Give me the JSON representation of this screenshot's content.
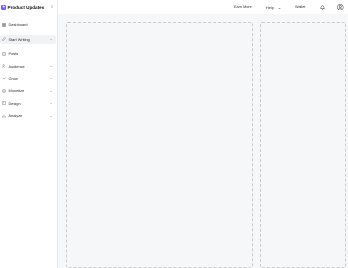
{
  "brand": {
    "name": "Product Updates",
    "logo_icon": "bolt-icon",
    "color": "#7c5cff"
  },
  "topbar": {
    "earn_more": "Earn More",
    "help": "Help",
    "wallet": "Wallet",
    "notifications_icon": "bell-icon",
    "avatar_icon": "user-avatar-icon"
  },
  "sidebar": {
    "items": [
      {
        "label": "Dashboard",
        "icon": "dashboard-icon",
        "has_chevron": false
      },
      {
        "label": "Start Writing",
        "icon": "pencil-icon",
        "has_chevron": true,
        "active": true
      },
      {
        "label": "Posts",
        "icon": "document-icon",
        "has_chevron": false
      },
      {
        "label": "Audience",
        "icon": "users-icon",
        "has_chevron": true
      },
      {
        "label": "Grow",
        "icon": "trend-icon",
        "has_chevron": true
      },
      {
        "label": "Monetize",
        "icon": "dollar-icon",
        "has_chevron": true
      },
      {
        "label": "Design",
        "icon": "palette-icon",
        "has_chevron": true
      },
      {
        "label": "Analyze",
        "icon": "bar-chart-icon",
        "has_chevron": true
      }
    ]
  },
  "colors": {
    "accent": "#7c5cff",
    "sidebar_bg": "#ffffff",
    "page_bg": "#f6f7f9",
    "dashed_border": "#c9cdd2"
  }
}
